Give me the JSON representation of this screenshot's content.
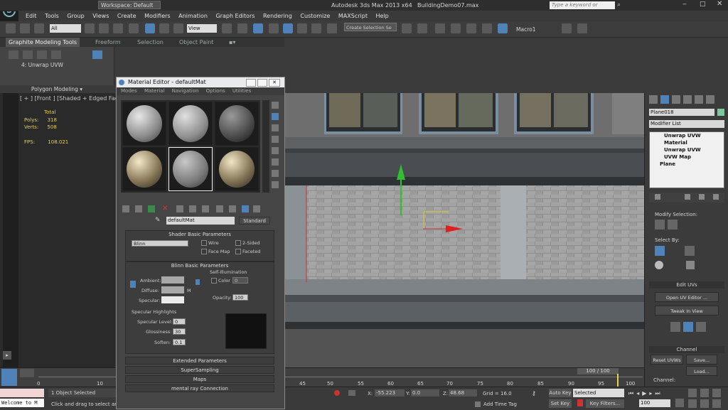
{
  "app": {
    "workspace": "Workspace: Default",
    "title": "Autodesk 3ds Max  2013 x64",
    "file": "BuildingDemo07.max",
    "search_placeholder": "Type a keyword or phrase"
  },
  "menu": [
    "Edit",
    "Tools",
    "Group",
    "Views",
    "Create",
    "Modifiers",
    "Animation",
    "Graph Editors",
    "Rendering",
    "Customize",
    "MAXScript",
    "Help"
  ],
  "toolbar": {
    "filter": "All",
    "refcoord": "View",
    "selection_set": "Create Selection Se",
    "macro": "Macro1"
  },
  "ribbon": {
    "tabs": [
      "Graphite Modeling Tools",
      "Freeform",
      "Selection",
      "Object Paint"
    ],
    "current_op": "4: Unwrap UVW",
    "panel": "Polygon Modeling"
  },
  "viewport": {
    "label": "[ + ] [Front ] [Shaded + Edged Faces ]",
    "stats_header": "Total",
    "polys_label": "Polys:",
    "polys": "318",
    "verts_label": "Verts:",
    "verts": "508",
    "fps_label": "FPS:",
    "fps": "108.021"
  },
  "material_editor": {
    "title": "Material Editor - defaultMat",
    "menu": [
      "Modes",
      "Material",
      "Navigation",
      "Options",
      "Utilities"
    ],
    "material_name": "defaultMat",
    "material_type": "Standard",
    "shader_header": "Shader Basic Parameters",
    "shader": "Blinn",
    "wire": "Wire",
    "two_sided": "2-Sided",
    "face_map": "Face Map",
    "faceted": "Faceted",
    "blinn_header": "Blinn Basic Parameters",
    "self_illum": "Self-Illumination",
    "color": "Color",
    "color_val": "0",
    "ambient": "Ambient:",
    "diffuse": "Diffuse:",
    "specular": "Specular:",
    "opacity": "Opacity:",
    "opacity_val": "100",
    "spec_highlights": "Specular Highlights",
    "spec_level": "Specular Level:",
    "spec_level_val": "0",
    "glossiness": "Glossiness:",
    "glossiness_val": "30",
    "soften": "Soften:",
    "soften_val": "0.1",
    "m_label": "M",
    "rollouts": [
      "Extended Parameters",
      "SuperSampling",
      "Maps",
      "mental ray Connection"
    ]
  },
  "command_panel": {
    "object_name": "Plane018",
    "modifier_list": "Modifier List",
    "stack": [
      "Unwrap UVW",
      "Material",
      "Unwrap UVW",
      "UVW Map",
      "Plane"
    ],
    "modify_selection": "Modify Selection:",
    "select_by": "Select By:",
    "edit_uvs": "Edit UVs",
    "open_uv_editor": "Open UV Editor ...",
    "tweak_in_view": "Tweak In View",
    "channel": "Channel",
    "reset_uvws": "Reset UVWs",
    "save": "Save...",
    "load": "Load...",
    "channel_label": "Channel:"
  },
  "timeline": {
    "frame": "100 / 100",
    "ticks": [
      "0",
      "10",
      "45",
      "50",
      "55",
      "60",
      "65",
      "70",
      "75",
      "80",
      "85",
      "90",
      "95",
      "100"
    ]
  },
  "status": {
    "listener": "Welcome to M",
    "selected": "1 Object Selected",
    "prompt": "Click and drag to select and",
    "x_label": "X:",
    "x": "-55.223",
    "y_label": "Y:",
    "y": "0.0",
    "z_label": "Z:",
    "z": "48.68",
    "grid": "Grid = 16.0",
    "add_time_tag": "Add Time Tag",
    "auto_key": "Auto Key",
    "set_key": "Set Key",
    "key_mode": "Selected",
    "key_filters": "Key Filters...",
    "current_frame": "100"
  }
}
